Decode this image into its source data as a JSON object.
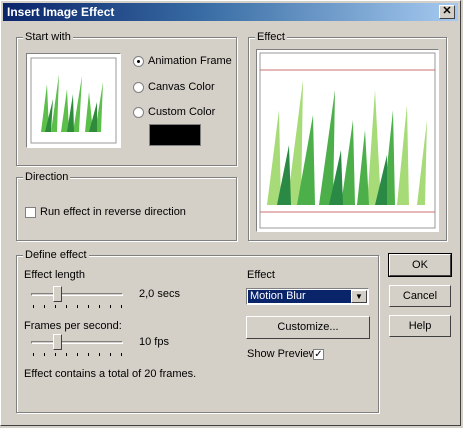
{
  "window": {
    "title": "Insert Image Effect",
    "close_glyph": "✕"
  },
  "start_with": {
    "legend": "Start with",
    "options": [
      "Animation Frame",
      "Canvas Color",
      "Custom Color"
    ],
    "selected": "Animation Frame",
    "custom_color": "#000000"
  },
  "effect_preview": {
    "legend": "Effect"
  },
  "direction": {
    "legend": "Direction",
    "reverse_label": "Run effect in reverse direction",
    "reverse_checked": false
  },
  "define": {
    "legend": "Define effect",
    "length_label": "Effect length",
    "length_value": "2,0 secs",
    "fps_label": "Frames per second:",
    "fps_value": "10 fps",
    "summary": "Effect contains a total of 20 frames.",
    "effect_label": "Effect",
    "effect_value": "Motion Blur",
    "customize_label": "Customize...",
    "show_preview_label": "Show Preview",
    "show_preview_checked": true,
    "check_glyph": "✓",
    "dropdown_glyph": "▼"
  },
  "buttons": {
    "ok": "OK",
    "cancel": "Cancel",
    "help": "Help"
  },
  "colors": {
    "face": "#d4d0c8",
    "titlebar": "#0a246a",
    "selection": "#0a246a"
  },
  "icons": [
    "close-icon",
    "chevron-down-icon",
    "checkmark-icon"
  ]
}
